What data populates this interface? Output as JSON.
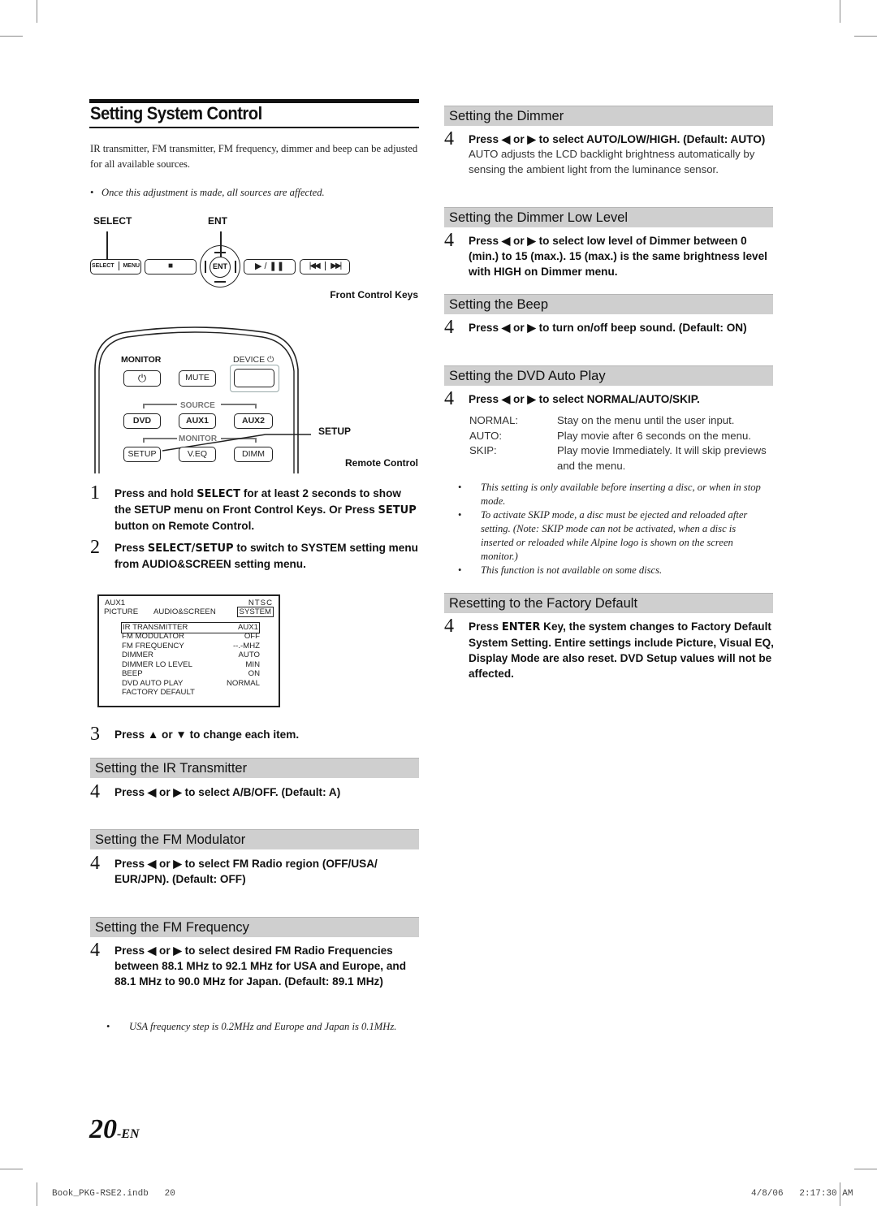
{
  "page": {
    "title": "Setting System Control",
    "intro": "IR transmitter, FM transmitter, FM frequency, dimmer and beep can be adjusted for all available sources.",
    "intro_note": "Once this adjustment is made, all sources are affected.",
    "page_number": "20",
    "page_suffix": "-EN"
  },
  "front_keys": {
    "label_select": "SELECT",
    "label_ent": "ENT",
    "caption": "Front Control Keys",
    "keys": {
      "select": "SELECT",
      "menu": "MENU",
      "stop": "■",
      "ent": "ENT",
      "play_pause": "▶ / ❚❚",
      "prev": "|◀◀",
      "next": "▶▶|"
    }
  },
  "remote": {
    "caption": "Remote Control",
    "callout_setup": "SETUP",
    "monitor_label": "MONITOR",
    "device_label": "DEVICE",
    "source_group": "SOURCE",
    "monitor_group": "MONITOR",
    "buttons": {
      "power": "⏻",
      "mute": "MUTE",
      "device": "",
      "dvd": "DVD",
      "aux1": "AUX1",
      "aux2": "AUX2",
      "setup": "SETUP",
      "veq": "V.EQ",
      "dimm": "DIMM"
    }
  },
  "steps_left": [
    {
      "num": "1",
      "text_parts": [
        "Press and hold ",
        "SELECT",
        " for at least 2 seconds to show the SETUP menu on Front Control Keys. Or Press ",
        "SETUP",
        " button on Remote Control."
      ]
    },
    {
      "num": "2",
      "text_parts": [
        "Press ",
        "SELECT/SETUP",
        " to switch to SYSTEM setting menu from AUDIO&SCREEN setting menu."
      ]
    },
    {
      "num": "3",
      "text": "Press ▲ or ▼ to change each item."
    }
  ],
  "osd": {
    "source": "AUX1",
    "format": "NTSC",
    "tabs": [
      "PICTURE",
      "AUDIO&SCREEN",
      "SYSTEM"
    ],
    "active_tab": "SYSTEM",
    "items": [
      {
        "label": "IR TRANSMITTER",
        "value": "AUX1",
        "selected": true
      },
      {
        "label": "FM MODULATOR",
        "value": "OFF"
      },
      {
        "label": "FM FREQUENCY",
        "value": "--.-MHZ"
      },
      {
        "label": "DIMMER",
        "value": "AUTO"
      },
      {
        "label": "DIMMER LO LEVEL",
        "value": "MIN"
      },
      {
        "label": "BEEP",
        "value": "ON"
      },
      {
        "label": "DVD AUTO PLAY",
        "value": "NORMAL"
      },
      {
        "label": "FACTORY DEFAULT",
        "value": ""
      }
    ]
  },
  "sections": {
    "ir": {
      "heading": "Setting the IR Transmitter",
      "num": "4",
      "text": "Press ◀ or ▶ to select A/B/OFF. (Default: A)"
    },
    "fm_mod": {
      "heading": "Setting the FM Modulator",
      "num": "4",
      "text": "Press ◀ or ▶ to select FM Radio region (OFF/USA/ EUR/JPN). (Default: OFF)"
    },
    "fm_freq": {
      "heading": "Setting the  FM Frequency",
      "num": "4",
      "text": "Press ◀ or ▶ to select desired FM Radio Frequencies between 88.1 MHz to 92.1 MHz for USA and Europe, and 88.1 MHz to 90.0 MHz for Japan. (Default: 89.1 MHz)",
      "note": "USA frequency step is 0.2MHz and Europe and Japan is 0.1MHz."
    },
    "dimmer": {
      "heading": "Setting the Dimmer",
      "num": "4",
      "text": "Press ◀ or ▶ to select AUTO/LOW/HIGH. (Default: AUTO)",
      "sub": "AUTO adjusts the LCD backlight brightness automatically by sensing the ambient light from the luminance sensor."
    },
    "dimmer_low": {
      "heading": "Setting the Dimmer Low Level",
      "num": "4",
      "text": "Press ◀ or ▶ to select low level of Dimmer between 0 (min.) to 15 (max.). 15 (max.) is the same brightness level with HIGH on Dimmer menu."
    },
    "beep": {
      "heading": "Setting the Beep",
      "num": "4",
      "text": "Press ◀ or ▶ to turn on/off beep sound. (Default: ON)"
    },
    "dvd_auto": {
      "heading": "Setting the DVD Auto Play",
      "num": "4",
      "text": "Press ◀ or ▶ to select NORMAL/AUTO/SKIP.",
      "options": [
        {
          "key": "NORMAL:",
          "desc": "Stay on the menu until the user input."
        },
        {
          "key": "AUTO:",
          "desc": "Play movie after 6 seconds on the menu."
        },
        {
          "key": "SKIP:",
          "desc": "Play movie Immediately. It will skip previews and the menu."
        }
      ],
      "notes": [
        "This setting is only available before inserting a disc, or when in stop mode.",
        "To activate SKIP mode, a disc must be ejected and reloaded after setting. (Note: SKIP mode can not be activated, when a disc is inserted or reloaded while Alpine logo is shown on the screen monitor.)",
        "This function is not available on some discs."
      ]
    },
    "factory": {
      "heading": "Resetting to the Factory Default",
      "num": "4",
      "text_parts": [
        "Press ",
        "ENTER",
        " Key, the system changes to Factory Default System Setting. Entire settings include Picture, Visual EQ, Display Mode are also reset. DVD Setup values will not be affected."
      ]
    }
  },
  "footer": {
    "file": "Book_PKG-RSE2.indb",
    "file_page": "20",
    "date": "4/8/06",
    "time": "2:17:30 AM"
  }
}
